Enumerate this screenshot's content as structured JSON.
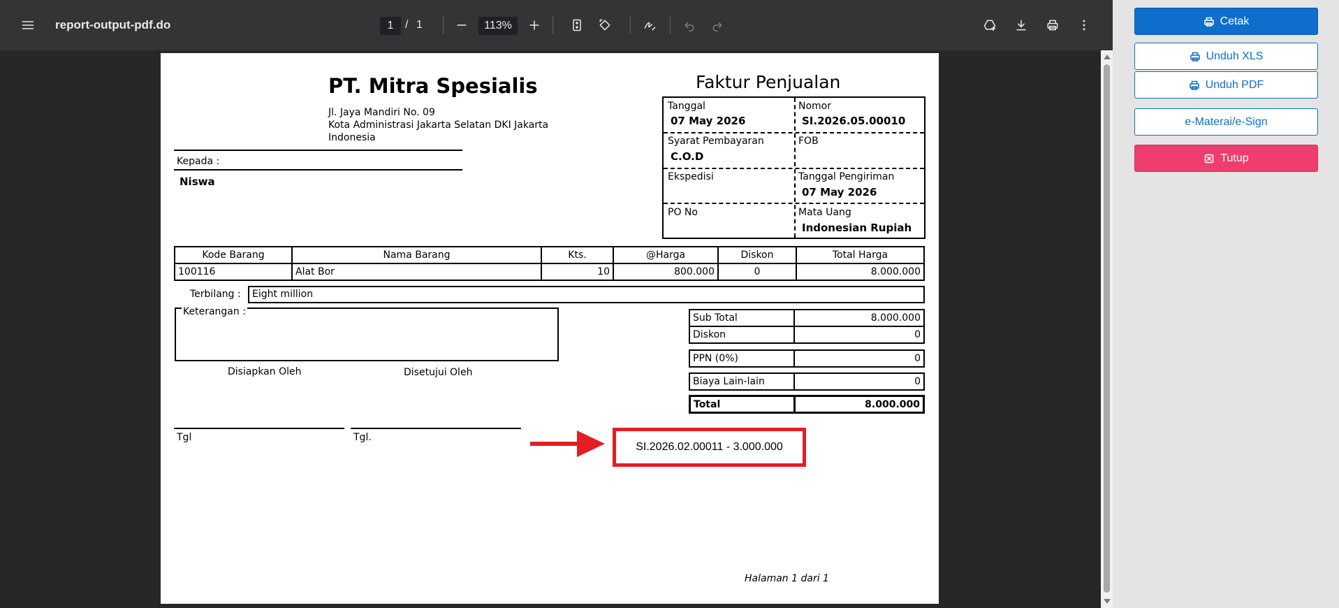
{
  "viewer": {
    "title": "report-output-pdf.do",
    "current_page": "1",
    "page_separator": "/",
    "total_pages": "1",
    "zoom": "113%"
  },
  "document": {
    "company_name": "PT. Mitra Spesialis",
    "address": [
      "Jl. Jaya Mandiri No. 09",
      "Kota Administrasi Jakarta Selatan DKI Jakarta",
      "Indonesia"
    ],
    "kepada_label": "Kepada :",
    "customer": "Niswa",
    "doc_title": "Faktur Penjualan",
    "info": {
      "tanggal_label": "Tanggal",
      "tanggal": "07 May 2026",
      "nomor_label": "Nomor",
      "nomor": "SI.2026.05.00010",
      "syarat_label": "Syarat Pembayaran",
      "syarat": "C.O.D",
      "fob_label": "FOB",
      "ekspedisi_label": "Ekspedisi",
      "tgl_kirim_label": "Tanggal Pengiriman",
      "tgl_kirim": "07 May 2026",
      "po_label": "PO No",
      "mata_uang_label": "Mata Uang",
      "mata_uang": "Indonesian Rupiah"
    },
    "table": {
      "headers": [
        "Kode Barang",
        "Nama Barang",
        "Kts.",
        "@Harga",
        "Diskon",
        "Total Harga"
      ],
      "rows": [
        [
          "100116",
          "Alat Bor",
          "10",
          "800.000",
          "0",
          "8.000.000"
        ]
      ]
    },
    "terbilang_label": "Terbilang :",
    "terbilang": "Eight million",
    "keterangan_label": "Keterangan :",
    "disiapkan_label": "Disiapkan Oleh",
    "disetujui_label": "Disetujui Oleh",
    "tgl1_label": "Tgl",
    "tgl2_label": "Tgl.",
    "summary": {
      "sub_total_label": "Sub Total",
      "sub_total": "8.000.000",
      "diskon_label": "Diskon",
      "diskon": "0",
      "ppn_label": "PPN (0%)",
      "ppn": "0",
      "biaya_label": "Biaya Lain-lain",
      "biaya": "0",
      "total_label": "Total",
      "total": "8.000.000"
    },
    "annotation": "SI.2026.02.00011 - 3.000.000",
    "annotation_color": "#e31e24",
    "page_footer": "Halaman 1 dari  1"
  },
  "sidebar": {
    "cetak": "Cetak",
    "unduh_xls": "Unduh XLS",
    "unduh_pdf": "Unduh PDF",
    "emeterai": "e-Materai/e-Sign",
    "tutup": "Tutup",
    "primary_color": "#0d6ecb",
    "danger_color": "#ee3d6e"
  }
}
